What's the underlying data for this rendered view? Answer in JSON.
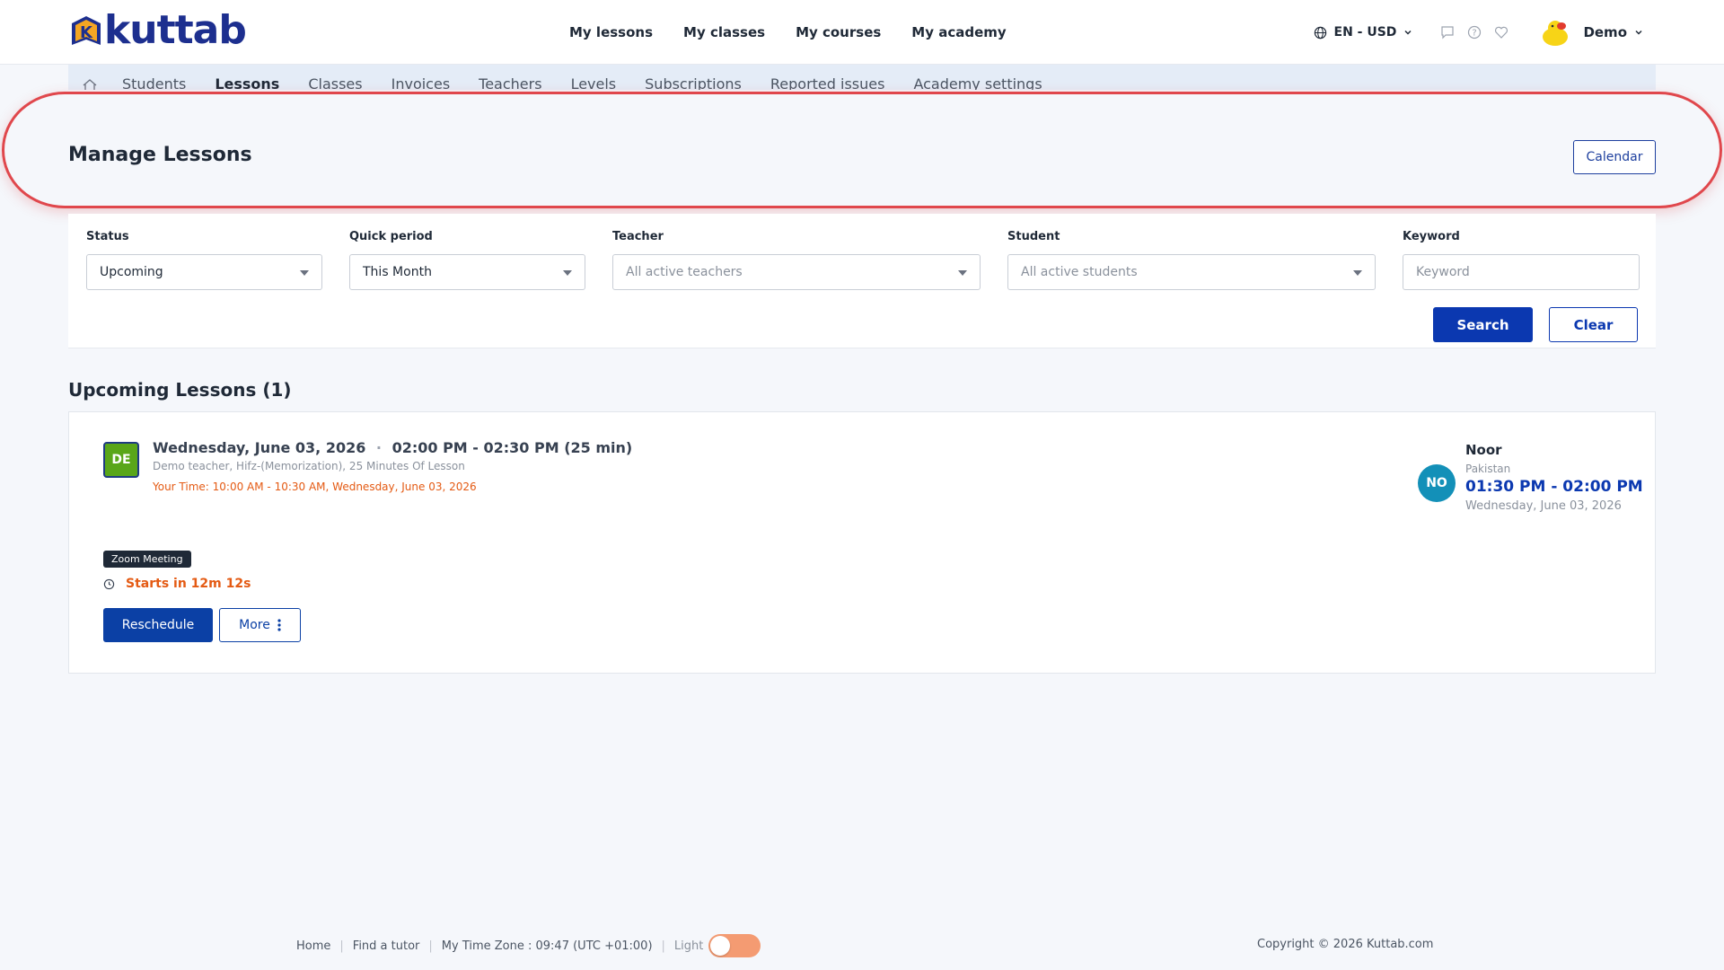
{
  "app": {
    "logo_text": "kuttab"
  },
  "topnav": {
    "items": [
      {
        "label": "My lessons"
      },
      {
        "label": "My classes"
      },
      {
        "label": "My courses"
      },
      {
        "label": "My academy"
      }
    ],
    "language": "EN - USD",
    "user_name": "Demo"
  },
  "subnav": {
    "tabs": [
      {
        "label": "Students"
      },
      {
        "label": "Lessons",
        "active": true
      },
      {
        "label": "Classes"
      },
      {
        "label": "Invoices"
      },
      {
        "label": "Teachers"
      },
      {
        "label": "Levels"
      },
      {
        "label": "Subscriptions"
      },
      {
        "label": "Reported issues"
      },
      {
        "label": "Academy settings"
      }
    ]
  },
  "header": {
    "title": "Manage Lessons",
    "calendar_label": "Calendar"
  },
  "filters": {
    "status": {
      "label": "Status",
      "value": "Upcoming"
    },
    "quick_period": {
      "label": "Quick period",
      "value": "This Month"
    },
    "teacher": {
      "label": "Teacher",
      "placeholder": "All active teachers"
    },
    "student": {
      "label": "Student",
      "placeholder": "All active students"
    },
    "keyword": {
      "label": "Keyword",
      "placeholder": "Keyword"
    },
    "search_label": "Search",
    "clear_label": "Clear"
  },
  "section": {
    "title": "Upcoming Lessons (1)"
  },
  "lesson": {
    "teacher_initials": "DE",
    "date": "Wednesday, June 03, 2026",
    "separator": "·",
    "time": "02:00 PM - 02:30 PM (25 min)",
    "meta": "Demo teacher, Hifz-(Memorization), 25 Minutes Of Lesson",
    "your_time": "Your Time: 10:00 AM - 10:30 AM, Wednesday, June 03, 2026",
    "meeting_tag": "Zoom Meeting",
    "starts_in": "Starts in 12m 12s",
    "reschedule_label": "Reschedule",
    "more_label": "More",
    "student": {
      "initials": "NO",
      "name": "Noor",
      "country": "Pakistan",
      "time": "01:30 PM - 02:00 PM",
      "date": "Wednesday, June 03, 2026"
    }
  },
  "footer": {
    "home": "Home",
    "find_tutor": "Find a tutor",
    "timezone": "My Time Zone : 09:47 (UTC +01:00)",
    "theme_label": "Light",
    "copyright": "Copyright © 2026 Kuttab.com"
  },
  "colors": {
    "brand": "#1d2f8f",
    "primary": "#0b38b0",
    "accent": "#e45a13",
    "highlight": "#e0474c"
  }
}
